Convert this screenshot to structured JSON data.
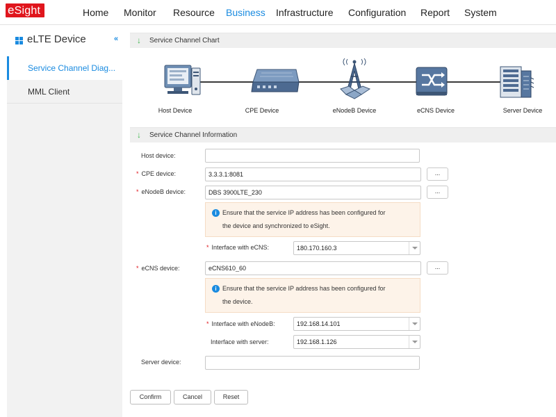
{
  "logo": {
    "first": "e",
    "rest": "Sight"
  },
  "nav": {
    "home": "Home",
    "monitor": "Monitor",
    "resource": "Resource",
    "business": "Business",
    "infrastructure": "Infrastructure",
    "configuration": "Configuration",
    "report": "Report",
    "system": "System"
  },
  "sidebar": {
    "title": "eLTE Device",
    "collapse_icon": "«",
    "items": [
      {
        "label": "Service Channel Diag..."
      },
      {
        "label": "MML Client"
      }
    ]
  },
  "chart": {
    "header": "Service Channel Chart",
    "nodes": [
      {
        "label": "Host Device",
        "icon": "host-device-icon"
      },
      {
        "label": "CPE Device",
        "icon": "cpe-device-icon"
      },
      {
        "label": "eNodeB Device",
        "icon": "enodeb-device-icon"
      },
      {
        "label": "eCNS Device",
        "icon": "ecns-device-icon"
      },
      {
        "label": "Server Device",
        "icon": "server-device-icon"
      }
    ]
  },
  "info": {
    "header": "Service Channel Information",
    "host_label": "Host device:",
    "host_value": "",
    "cpe_label": "CPE device:",
    "cpe_value": "3.3.3.1:8081",
    "enodeb_label": "eNodeB device:",
    "enodeb_value": "DBS 3900LTE_230",
    "enodeb_note_line1": "Ensure that the service IP address has been configured for",
    "enodeb_note_line2": "the device and synchronized to eSight.",
    "iface_ecns_label": "Interface with eCNS:",
    "iface_ecns_value": "180.170.160.3",
    "ecns_label": "eCNS device:",
    "ecns_value": "eCNS610_60",
    "ecns_note_line1": "Ensure that the service IP address has been configured for",
    "ecns_note_line2": "the device.",
    "iface_enodeb_label": "Interface with eNodeB:",
    "iface_enodeb_value": "192.168.14.101",
    "iface_server_label": "Interface with server:",
    "iface_server_value": "192.168.1.126",
    "server_label": "Server device:",
    "server_value": "",
    "browse_label": "...",
    "required_mark": "*",
    "info_icon": "i"
  },
  "buttons": {
    "confirm": "Confirm",
    "cancel": "Cancel",
    "reset": "Reset"
  },
  "colors": {
    "accent": "#1a8be0",
    "brand": "#e0161d",
    "required": "#e0161d",
    "note_bg": "#fdf3e9"
  }
}
